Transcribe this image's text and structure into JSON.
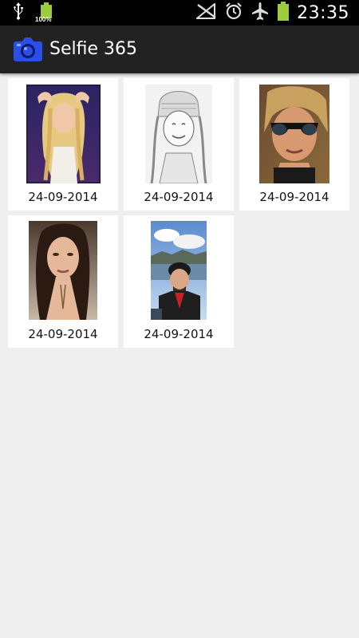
{
  "status_bar": {
    "battery_percent": "100%",
    "time": "23:35",
    "icons": [
      "usb-icon",
      "battery-icon",
      "no-signal-icon",
      "alarm-icon",
      "airplane-mode-icon",
      "battery-icon"
    ]
  },
  "action_bar": {
    "title": "Selfie 365",
    "icon": "camera-icon"
  },
  "gallery": {
    "items": [
      {
        "date": "24-09-2014"
      },
      {
        "date": "24-09-2014"
      },
      {
        "date": "24-09-2014"
      },
      {
        "date": "24-09-2014"
      },
      {
        "date": "24-09-2014"
      }
    ]
  },
  "colors": {
    "accent": "#2b4de8",
    "action_bar": "#222222",
    "background": "#efefef"
  }
}
